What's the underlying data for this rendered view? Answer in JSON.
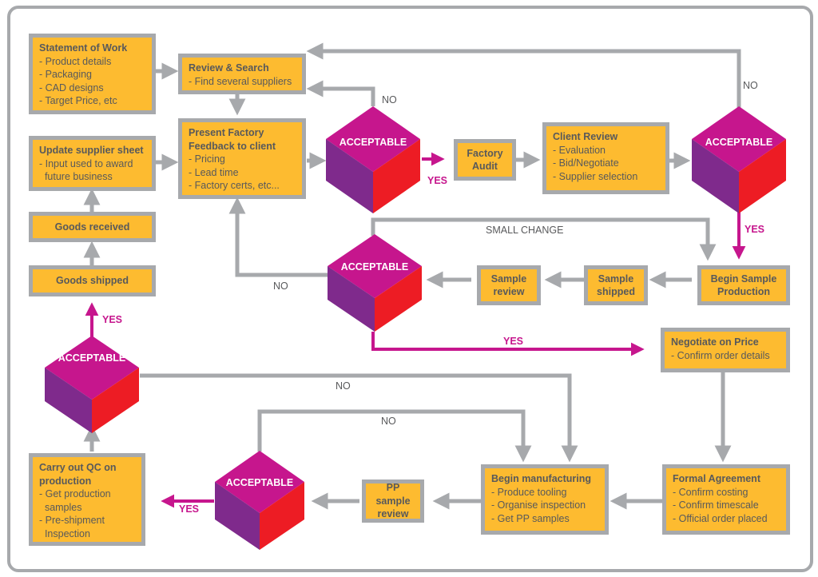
{
  "colors": {
    "box_fill": "#fdbb30",
    "box_border": "#a7a9ac",
    "connector_gray": "#a7a9ac",
    "connector_yes": "#c6168d",
    "cube_top": "#c6168d",
    "cube_left": "#7f2a8c",
    "cube_right": "#ed1c24",
    "text": "#58595b"
  },
  "boxes": {
    "statement_of_work": {
      "title": "Statement of Work",
      "lines": [
        "- Product details",
        "- Packaging",
        "- CAD designs",
        "- Target Price, etc"
      ]
    },
    "review_search": {
      "title": "Review & Search",
      "lines": [
        "- Find several suppliers"
      ]
    },
    "update_supplier": {
      "title": "Update supplier sheet",
      "lines": [
        "- Input used to award",
        "  future business"
      ]
    },
    "present_feedback": {
      "title": "Present Factory",
      "title2": "Feedback to client",
      "lines": [
        "- Pricing",
        "- Lead time",
        "- Factory certs, etc..."
      ]
    },
    "factory_audit": {
      "title": "Factory",
      "title2": "Audit"
    },
    "client_review": {
      "title": "Client Review",
      "lines": [
        "- Evaluation",
        "- Bid/Negotiate",
        "- Supplier selection"
      ]
    },
    "goods_received": {
      "title": "Goods received"
    },
    "goods_shipped": {
      "title": "Goods shipped"
    },
    "sample_review": {
      "title": "Sample",
      "title2": "review"
    },
    "sample_shipped": {
      "title": "Sample",
      "title2": "shipped"
    },
    "begin_sample": {
      "title": "Begin Sample",
      "title2": "Production"
    },
    "negotiate_price": {
      "title": "Negotiate on Price",
      "lines": [
        "- Confirm order details"
      ]
    },
    "carry_out_qc": {
      "title": "Carry out QC on",
      "title2": "production",
      "lines": [
        "- Get production",
        "  samples",
        "- Pre-shipment",
        "  Inspection"
      ]
    },
    "pp_sample_review": {
      "title": "PP sample",
      "title2": "review"
    },
    "begin_manufacturing": {
      "title": "Begin manufacturing",
      "lines": [
        "- Produce tooling",
        "- Organise inspection",
        "- Get PP samples"
      ]
    },
    "formal_agreement": {
      "title": "Formal Agreement",
      "lines": [
        "- Confirm costing",
        "- Confirm timescale",
        "- Official order placed"
      ]
    }
  },
  "decisions": {
    "d1": "ACCEPTABLE",
    "d2": "ACCEPTABLE",
    "d3": "ACCEPTABLE",
    "d4": "ACCEPTABLE",
    "d5": "ACCEPTABLE"
  },
  "labels": {
    "no": "NO",
    "yes": "YES",
    "small_change": "SMALL CHANGE"
  }
}
